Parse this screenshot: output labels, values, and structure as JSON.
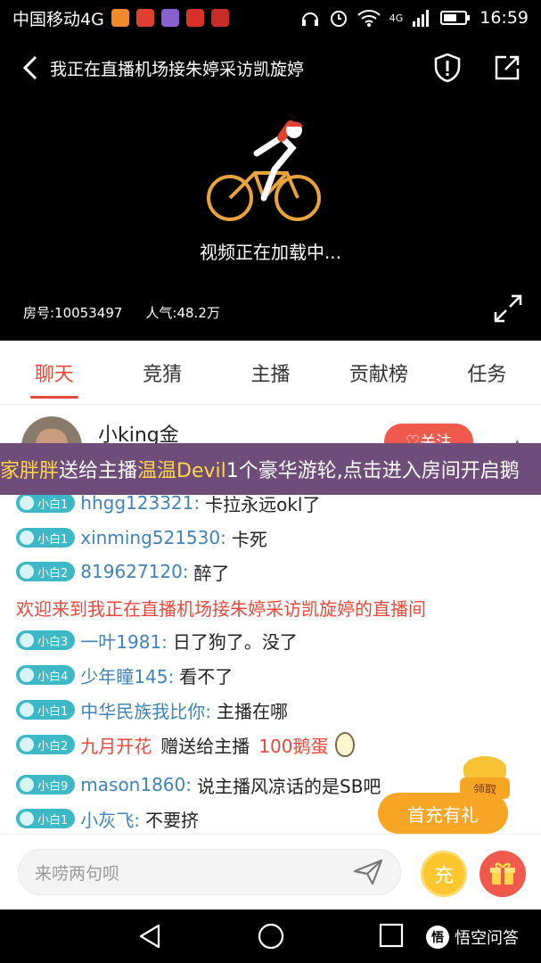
{
  "statusbar": {
    "carrier": "中国移动4G",
    "net": "4G",
    "time": "16:59"
  },
  "player": {
    "title": "我正在直播机场接朱婷采访凯旋婷",
    "loading_text": "视频正在加载中...",
    "room_label": "房号:10053497",
    "popularity_label": "人气:48.2万"
  },
  "tabs": [
    {
      "label": "聊天"
    },
    {
      "label": "竞猜"
    },
    {
      "label": "主播"
    },
    {
      "label": "贡献榜"
    },
    {
      "label": "任务"
    }
  ],
  "anchor": {
    "name": "小king金",
    "follow_label": "关注"
  },
  "banner": {
    "user": "家胖胖",
    "text1": "送给主播",
    "anchor": "温温Devil",
    "text2": "1个豪华游轮,点击进入房间开启鹅"
  },
  "chat": {
    "messages": [
      {
        "badge": "小白1",
        "user": "hhgg123321:",
        "text": "卡拉永远okl了"
      },
      {
        "badge": "小白1",
        "user": "xinming521530:",
        "text": "卡死"
      },
      {
        "badge": "小白2",
        "user": "819627120:",
        "text": "醉了"
      },
      {
        "badge": "小白3",
        "user": "一叶1981:",
        "text": "日了狗了。没了"
      },
      {
        "badge": "小白4",
        "user": "少年瞳145:",
        "text": "看不了"
      },
      {
        "badge": "小白1",
        "user": "中华民族我比你:",
        "text": "主播在哪"
      },
      {
        "badge": "小白2",
        "user": "九月开花",
        "text": "赠送给主播",
        "amount": "100鹅蛋"
      },
      {
        "badge": "小白9",
        "user": "mason1860:",
        "text": "说主播风凉话的是SB吧"
      },
      {
        "badge": "小白1",
        "user": "小灰飞:",
        "text": "不要挤"
      }
    ],
    "welcome": "欢迎来到我正在直播机场接朱婷采访凯旋婷的直播间"
  },
  "promo": {
    "first_charge": "首充有礼",
    "redpack_label": "领取"
  },
  "inputbar": {
    "placeholder": "来唠两句呗",
    "charge_label": "充"
  },
  "watermark": {
    "icon": "悟",
    "text": "悟空问答"
  }
}
